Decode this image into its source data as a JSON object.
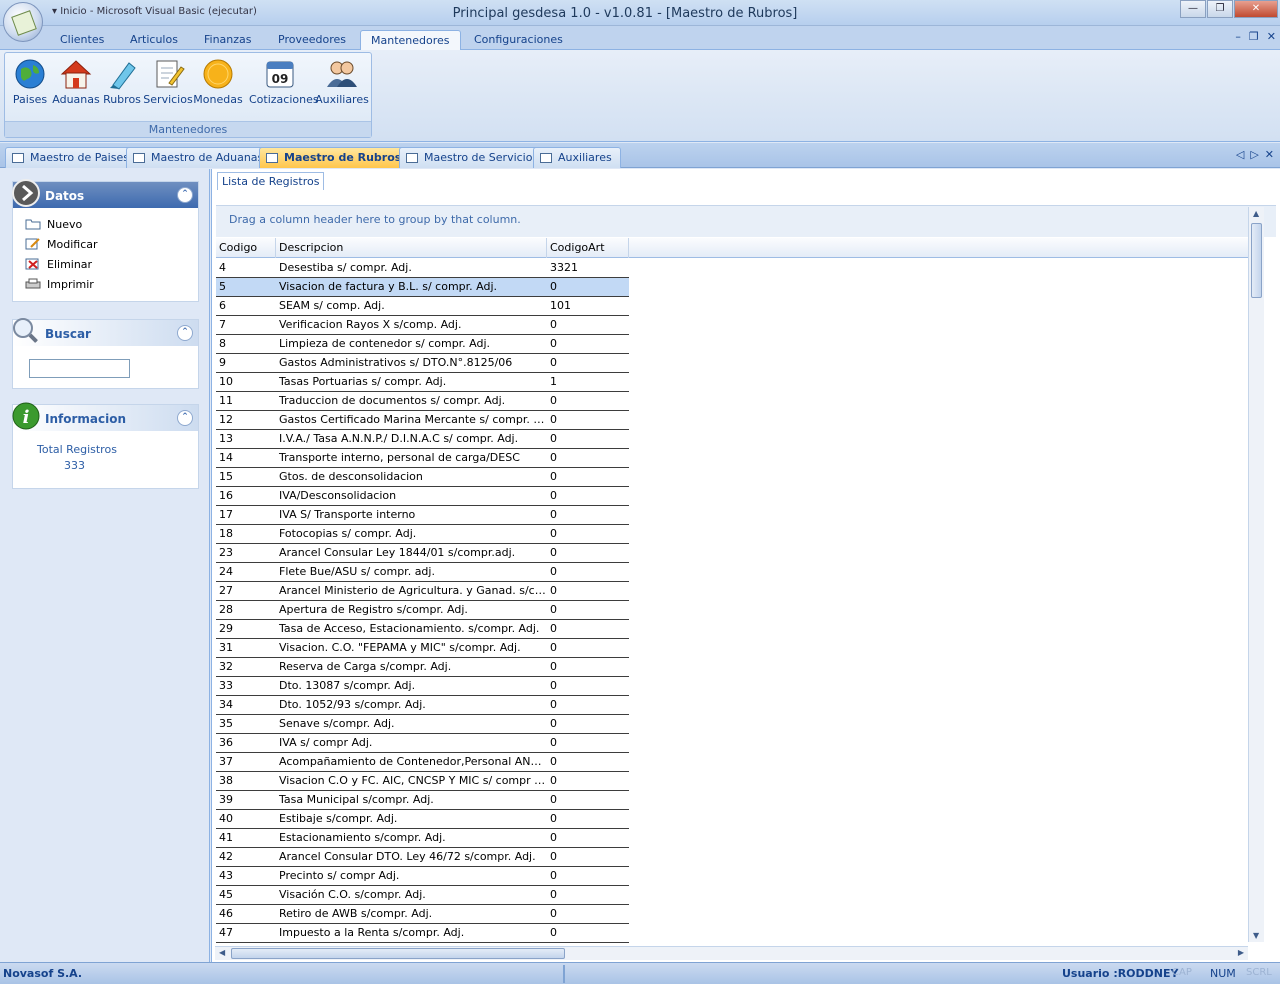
{
  "window": {
    "title": "Principal gesdesa 1.0 - v1.0.81 - [Maestro de Rubros]",
    "qat": "▾  Inicio - Microsoft Visual Basic (ejecutar)"
  },
  "ribbon_tabs": [
    "Clientes",
    "Articulos",
    "Finanzas",
    "Proveedores",
    "Mantenedores",
    "Configuraciones"
  ],
  "ribbon_group": {
    "label": "Mantenedores",
    "buttons": [
      "Paises",
      "Aduanas",
      "Rubros",
      "Servicios",
      "Monedas",
      "Cotizaciones",
      "Auxiliares"
    ],
    "calendar_day": "09"
  },
  "doc_tabs": [
    "Maestro de Paises",
    "Maestro de Aduanas",
    "Maestro de Rubros",
    "Maestro de Servicios",
    "Auxiliares"
  ],
  "left": {
    "datos": {
      "title": "Datos",
      "items": [
        "Nuevo",
        "Modificar",
        "Eliminar",
        "Imprimir"
      ]
    },
    "buscar": {
      "title": "Buscar",
      "value": ""
    },
    "info": {
      "title": "Informacion",
      "label": "Total Registros",
      "value": "333"
    }
  },
  "content": {
    "tab": "Lista de Registros",
    "group_hint": "Drag a column header here to group by that column."
  },
  "grid": {
    "columns": [
      "Codigo",
      "Descripcion",
      "CodigoArt"
    ],
    "selected": 1,
    "rows": [
      [
        "4",
        "Desestiba s/ compr. Adj.",
        "3321"
      ],
      [
        "5",
        "Visacion de factura y B.L. s/ compr. Adj.",
        "0"
      ],
      [
        "6",
        "SEAM s/ comp. Adj.",
        "101"
      ],
      [
        "7",
        "Verificacion Rayos X s/comp. Adj.",
        "0"
      ],
      [
        "8",
        "Limpieza de contenedor s/ compr. Adj.",
        "0"
      ],
      [
        "9",
        "Gastos Administrativos s/ DTO.N°.8125/06",
        "0"
      ],
      [
        "10",
        "Tasas Portuarias s/ compr. Adj.",
        "1"
      ],
      [
        "11",
        "Traduccion de documentos s/ compr. Adj.",
        "0"
      ],
      [
        "12",
        "Gastos Certificado Marina Mercante s/ compr. Adj.",
        "0"
      ],
      [
        "13",
        "I.V.A./ Tasa A.N.N.P./ D.I.N.A.C s/ compr. Adj.",
        "0"
      ],
      [
        "14",
        "Transporte interno, personal de carga/DESC",
        "0"
      ],
      [
        "15",
        "Gtos. de desconsolidacion",
        "0"
      ],
      [
        "16",
        "IVA/Desconsolidacion",
        "0"
      ],
      [
        "17",
        "IVA S/ Transporte interno",
        "0"
      ],
      [
        "18",
        "Fotocopias s/ compr. Adj.",
        "0"
      ],
      [
        "23",
        "Arancel Consular Ley 1844/01 s/compr.adj.",
        "0"
      ],
      [
        "24",
        "Flete Bue/ASU s/ compr. adj.",
        "0"
      ],
      [
        "27",
        "Arancel Ministerio de Agricultura. y Ganad. s/compr. Adj.",
        "0"
      ],
      [
        "28",
        "Apertura de Registro s/compr. Adj.",
        "0"
      ],
      [
        "29",
        "Tasa de Acceso, Estacionamiento. s/compr. Adj.",
        "0"
      ],
      [
        "31",
        "Visacion. C.O. \"FEPAMA y MIC\" s/compr. Adj.",
        "0"
      ],
      [
        "32",
        "Reserva de Carga s/compr. Adj.",
        "0"
      ],
      [
        "33",
        "Dto. 13087 s/compr. Adj.",
        "0"
      ],
      [
        "34",
        "Dto. 1052/93 s/compr. Adj.",
        "0"
      ],
      [
        "35",
        "Senave s/compr. Adj.",
        "0"
      ],
      [
        "36",
        "IVA s/ compr Adj.",
        "0"
      ],
      [
        "37",
        "Acompañamiento de Contenedor,Personal ANNP y Aduana",
        "0"
      ],
      [
        "38",
        "Visacion C.O y FC. AIC, CNCSP Y MIC s/ compr Adj.",
        "0"
      ],
      [
        "39",
        "Tasa Municipal s/compr. Adj.",
        "0"
      ],
      [
        "40",
        "Estibaje s/compr. Adj.",
        "0"
      ],
      [
        "41",
        "Estacionamiento s/compr. Adj.",
        "0"
      ],
      [
        "42",
        "Arancel Consular DTO. Ley 46/72 s/compr. Adj.",
        "0"
      ],
      [
        "43",
        "Precinto s/ compr Adj.",
        "0"
      ],
      [
        "45",
        "Visación C.O. s/compr. Adj.",
        "0"
      ],
      [
        "46",
        "Retiro de AWB s/compr. Adj.",
        "0"
      ],
      [
        "47",
        "Impuesto a la Renta s/compr. Adj.",
        "0"
      ]
    ]
  },
  "status": {
    "company": "Novasof S.A.",
    "user": "Usuario :RODDNEY",
    "caps": "CAP",
    "num": "NUM",
    "scrl": "SCRL"
  },
  "colors": {
    "accent": "#15428b",
    "selected_row": "#c2d9f5",
    "active_tab": "#ffc64c"
  }
}
